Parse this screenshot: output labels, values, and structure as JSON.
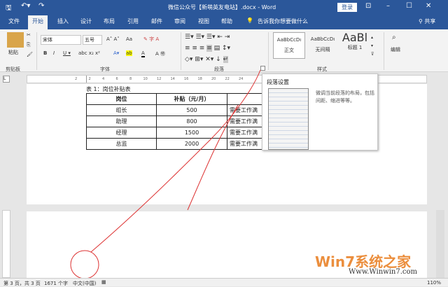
{
  "title": "微信公众号【新萌英友电站】.docx - Word",
  "titlebar": {
    "login": "登录"
  },
  "tabs": [
    "文件",
    "开始",
    "插入",
    "设计",
    "布局",
    "引用",
    "邮件",
    "审阅",
    "视图",
    "帮助"
  ],
  "tell_me": "告诉我你想要做什么",
  "share": "共享",
  "clipboard": {
    "paste": "粘贴",
    "label": "剪贴板"
  },
  "font": {
    "name": "宋体",
    "size": "五号",
    "label": "字体",
    "aa": "Aa"
  },
  "paragraph": {
    "label": "段落"
  },
  "styles": {
    "items": [
      {
        "preview": "AaBbCcDı",
        "name": "正文"
      },
      {
        "preview": "AaBbCcDı",
        "name": "无间隔"
      },
      {
        "preview": "AaBl",
        "name": "标题 1"
      }
    ],
    "label": "样式"
  },
  "editing": {
    "label": "编辑"
  },
  "ruler": [
    "2",
    "2",
    "4",
    "6",
    "8",
    "10",
    "12",
    "14",
    "16",
    "18",
    "20",
    "22",
    "24"
  ],
  "doc": {
    "caption": "表 1：岗位补贴表",
    "headers": [
      "岗位",
      "补贴（元/月）",
      ""
    ],
    "rows": [
      [
        "组长",
        "500",
        "需要工作满"
      ],
      [
        "助理",
        "800",
        "需要工作满"
      ],
      [
        "经理",
        "1500",
        "需要工作满"
      ],
      [
        "总监",
        "2000",
        "需要工作满"
      ]
    ]
  },
  "tooltip": {
    "title": "段落设置",
    "desc": "微调当前段落的布局，包括间距、缩进等等。"
  },
  "status": {
    "page": "第 3 页，共 3 页",
    "words": "1671 个字",
    "lang": "中文(中国)",
    "zoom": "110%"
  },
  "watermark": {
    "brand": "Win7系统之家",
    "url": "Www.Winwin7.com"
  }
}
